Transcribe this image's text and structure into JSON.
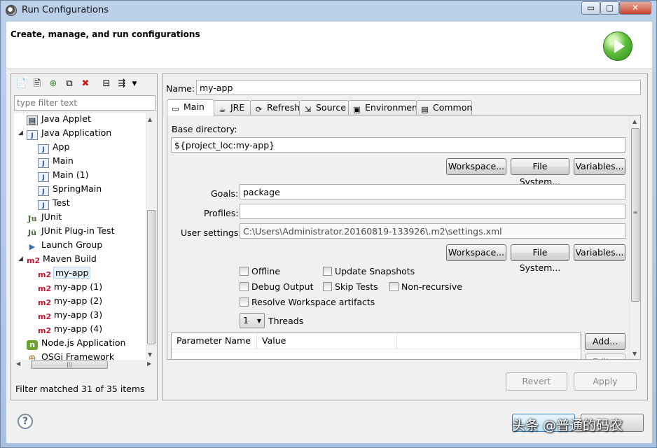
{
  "window": {
    "title": "Run Configurations",
    "min_glyph": "▭",
    "max_glyph": "▢",
    "close_glyph": "✕"
  },
  "header": {
    "title": "Create, manage, and run configurations",
    "icon": "run-play-icon"
  },
  "left": {
    "filter_placeholder": "type filter text",
    "tree": [
      {
        "label": "Java Applet",
        "icon": "java-applet-icon"
      },
      {
        "label": "Java Application",
        "icon": "java-application-icon",
        "expander": "◢"
      },
      {
        "label": "App",
        "icon": "java-class-icon"
      },
      {
        "label": "Main",
        "icon": "java-class-icon"
      },
      {
        "label": "Main (1)",
        "icon": "java-class-icon"
      },
      {
        "label": "SpringMain",
        "icon": "java-class-icon"
      },
      {
        "label": "Test",
        "icon": "java-class-icon"
      },
      {
        "label": "JUnit",
        "icon": "junit-icon"
      },
      {
        "label": "JUnit Plug-in Test",
        "icon": "junit-plugin-icon"
      },
      {
        "label": "Launch Group",
        "icon": "launch-group-icon"
      },
      {
        "label": "Maven Build",
        "icon": "maven-icon",
        "expander": "◢"
      },
      {
        "label": "my-app",
        "icon": "maven-icon",
        "selected": true
      },
      {
        "label": "my-app (1)",
        "icon": "maven-icon"
      },
      {
        "label": "my-app (2)",
        "icon": "maven-icon"
      },
      {
        "label": "my-app (3)",
        "icon": "maven-icon"
      },
      {
        "label": "my-app (4)",
        "icon": "maven-icon"
      },
      {
        "label": "Node.js Application",
        "icon": "nodejs-icon"
      },
      {
        "label": "OSGi Framework",
        "icon": "osgi-icon"
      }
    ],
    "status": "Filter matched 31 of 35 items"
  },
  "right": {
    "name_label": "Name:",
    "name_value": "my-app",
    "tabs": [
      {
        "label": "Main",
        "icon": "main-tab-icon",
        "active": true
      },
      {
        "label": "JRE",
        "icon": "jre-icon"
      },
      {
        "label": "Refresh",
        "icon": "refresh-icon"
      },
      {
        "label": "Source",
        "icon": "source-icon"
      },
      {
        "label": "Environment",
        "icon": "environment-icon"
      },
      {
        "label": "Common",
        "icon": "common-icon"
      }
    ],
    "base_dir_label": "Base directory:",
    "base_dir_value": "${project_loc:my-app}",
    "buttons_row1": [
      "Workspace...",
      "File System...",
      "Variables..."
    ],
    "goals_label": "Goals:",
    "goals_value": "package",
    "profiles_label": "Profiles:",
    "profiles_value": "",
    "user_settings_label": "User settings:",
    "user_settings_value": "C:\\Users\\Administrator.20160819-133926\\.m2\\settings.xml",
    "buttons_row2": [
      "Workspace...",
      "File System...",
      "Variables..."
    ],
    "checkboxes": {
      "offline": "Offline",
      "update_snapshots": "Update Snapshots",
      "debug_output": "Debug Output",
      "skip_tests": "Skip Tests",
      "non_recursive": "Non-recursive",
      "resolve_workspace": "Resolve Workspace artifacts"
    },
    "threads_value": "1",
    "threads_label": "Threads",
    "table_headers": [
      "Parameter Name",
      "Value"
    ],
    "add_button": "Add...",
    "edit_button": "Edit...",
    "revert_button": "Revert",
    "apply_button": "Apply"
  },
  "watermark": "头条 @普通的码农"
}
